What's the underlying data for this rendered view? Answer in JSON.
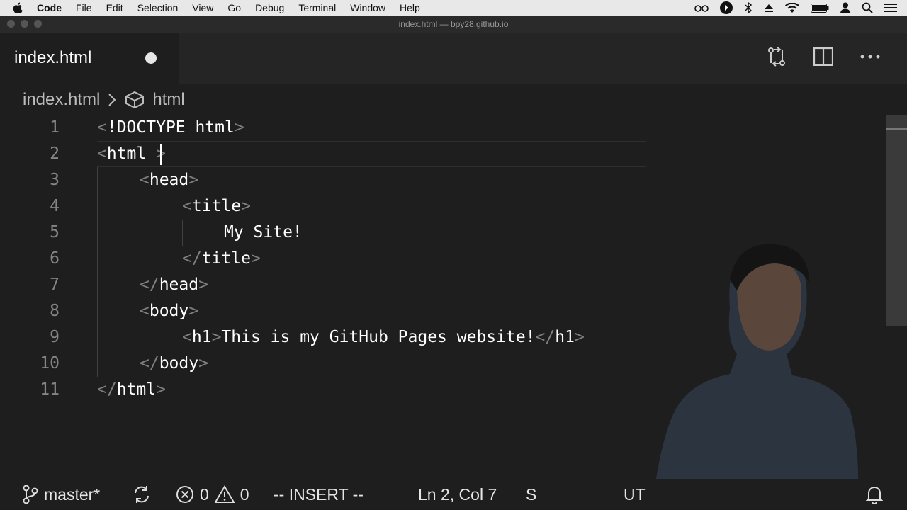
{
  "menubar": {
    "items": [
      "Code",
      "File",
      "Edit",
      "Selection",
      "View",
      "Go",
      "Debug",
      "Terminal",
      "Window",
      "Help"
    ],
    "status_icons": [
      "glasses-icon",
      "play-circle-icon",
      "bluetooth-icon",
      "eject-icon",
      "wifi-icon",
      "battery-icon",
      "user-icon",
      "search-icon",
      "list-icon"
    ]
  },
  "window": {
    "title": "index.html — bpy28.github.io"
  },
  "tab": {
    "title": "index.html",
    "modified": true
  },
  "editor_actions": [
    "compare-changes-icon",
    "split-editor-icon",
    "more-actions-icon"
  ],
  "breadcrumb": {
    "file": "index.html",
    "symbol": "html"
  },
  "code": {
    "line_numbers": [
      "1",
      "2",
      "3",
      "4",
      "5",
      "6",
      "7",
      "8",
      "9",
      "10",
      "11"
    ],
    "lines": [
      "<!DOCTYPE html>",
      "<html >",
      "<head>",
      "<title>",
      "My Site!",
      "</title>",
      "</head>",
      "<body>",
      "<h1>This is my GitHub Pages website!</h1>",
      "</body>",
      "</html>"
    ],
    "cursor": {
      "line": 2,
      "col": 7
    }
  },
  "statusbar": {
    "branch": "master*",
    "errors": "0",
    "warnings": "0",
    "mode": "-- INSERT --",
    "position": "Ln 2, Col 7",
    "partial_left": "S",
    "partial_right": "UT"
  },
  "colors": {
    "background": "#1e1e1e",
    "tabbar": "#252526",
    "line_number": "#858585",
    "tag_bracket": "#808080",
    "text": "#ffffff"
  }
}
